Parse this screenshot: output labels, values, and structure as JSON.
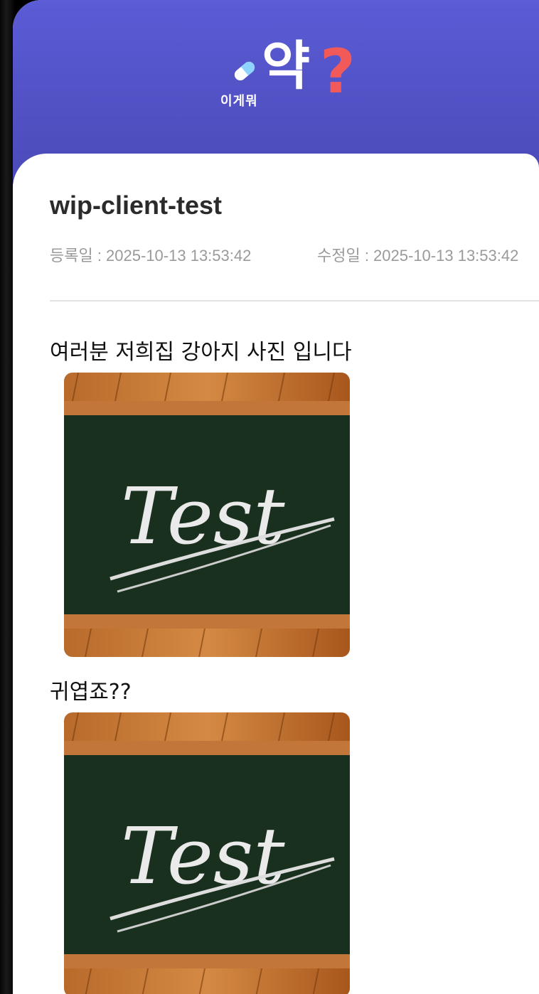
{
  "header": {
    "logo_small_text": "이게뭐",
    "logo_big_text": "약",
    "logo_question": "?",
    "bg_color": "#5b5cd6",
    "accent_color": "#f25a5a"
  },
  "post": {
    "title": "wip-client-test",
    "created": "등록일 : 2025-10-13 13:53:42",
    "modified": "수정일 : 2025-10-13 13:53:42",
    "paragraphs": [
      "여러분 저희집 강아지 사진 입니다",
      "귀엽죠??"
    ],
    "images": [
      {
        "icon": "chalkboard-image",
        "caption_text": "Test"
      },
      {
        "icon": "chalkboard-image",
        "caption_text": "Test"
      }
    ]
  }
}
